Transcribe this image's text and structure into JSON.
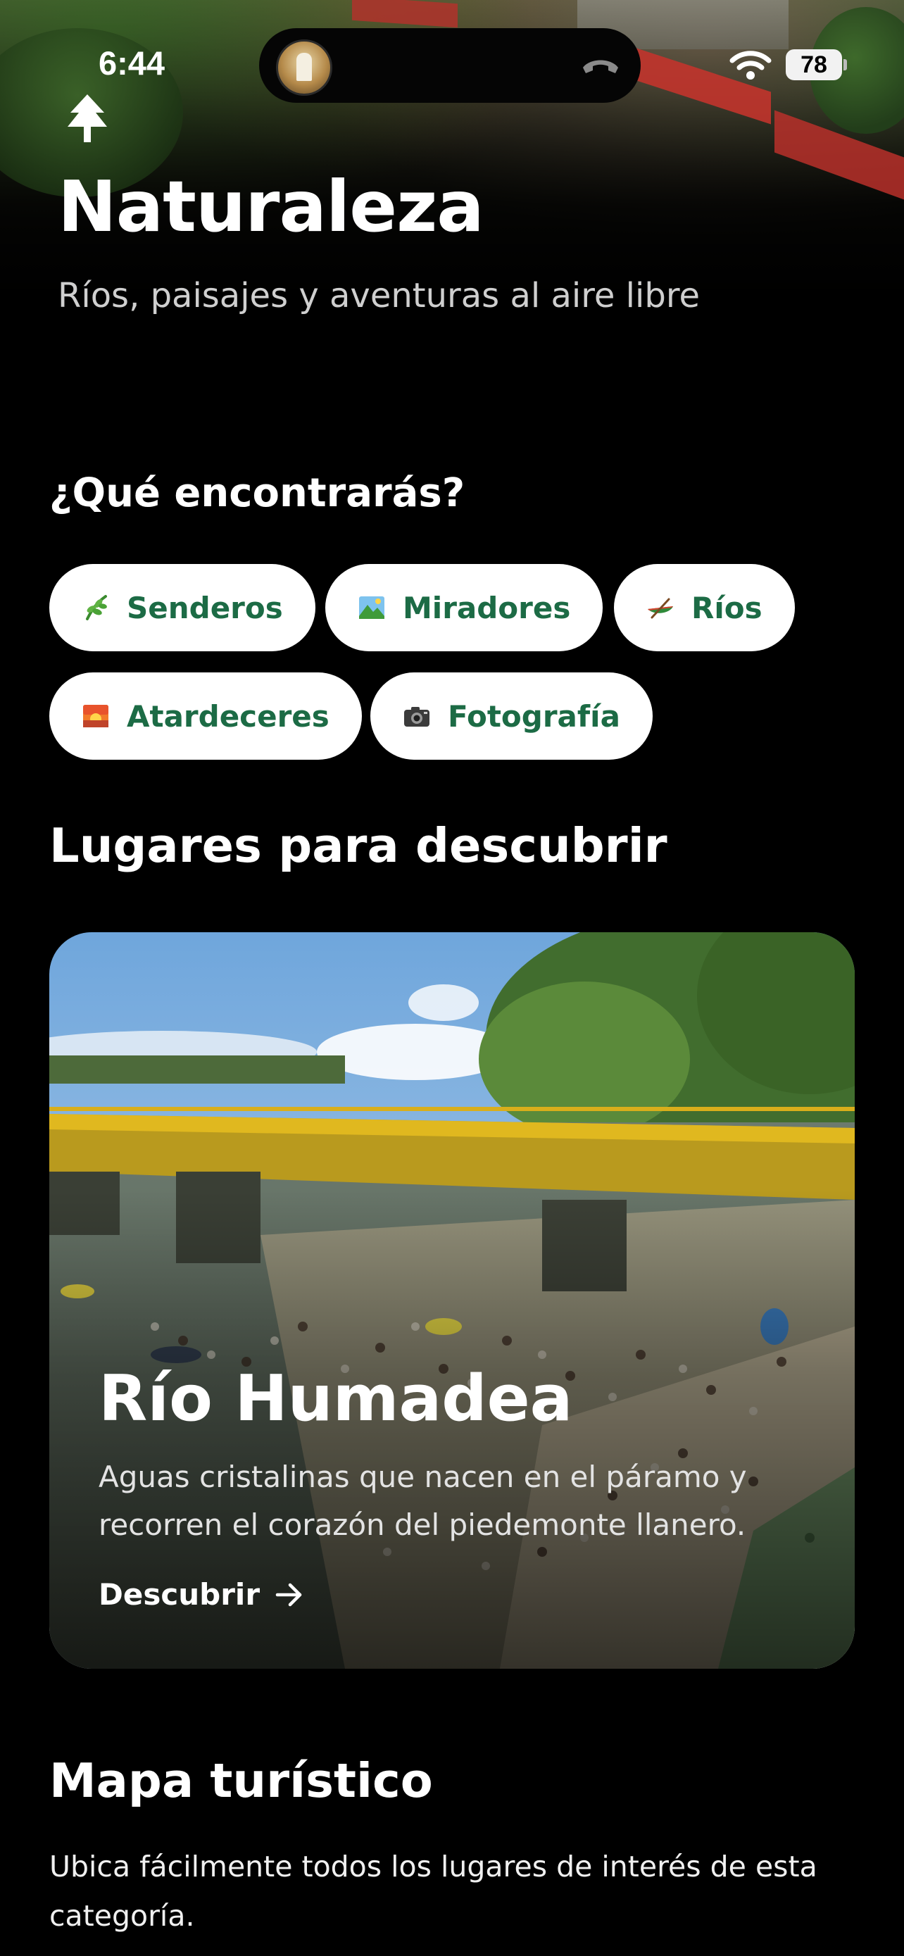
{
  "status_bar": {
    "time": "6:44",
    "battery": "78"
  },
  "hero": {
    "icon": "tree-icon",
    "title": "Naturaleza",
    "subtitle": "Ríos, paisajes y aventuras al aire libre"
  },
  "features": {
    "heading": "¿Qué encontrarás?",
    "chips": [
      {
        "label": "Senderos",
        "icon": "herb-icon"
      },
      {
        "label": "Miradores",
        "icon": "landscape-icon"
      },
      {
        "label": "Ríos",
        "icon": "canoe-icon"
      },
      {
        "label": "Atardeceres",
        "icon": "sunset-icon"
      },
      {
        "label": "Fotografía",
        "icon": "camera-icon"
      }
    ]
  },
  "places": {
    "heading": "Lugares para descubrir",
    "card": {
      "title": "Río Humadea",
      "description": "Aguas cristalinas que nacen en el páramo y recorren el corazón del piedemonte llanero.",
      "link_label": "Descubrir"
    }
  },
  "map": {
    "heading": "Mapa turístico",
    "description": "Ubica fácilmente todos los lugares de interés de esta categoría."
  },
  "colors": {
    "background": "#000000",
    "chip_background": "#ffffff",
    "chip_text": "#1c6b45"
  }
}
